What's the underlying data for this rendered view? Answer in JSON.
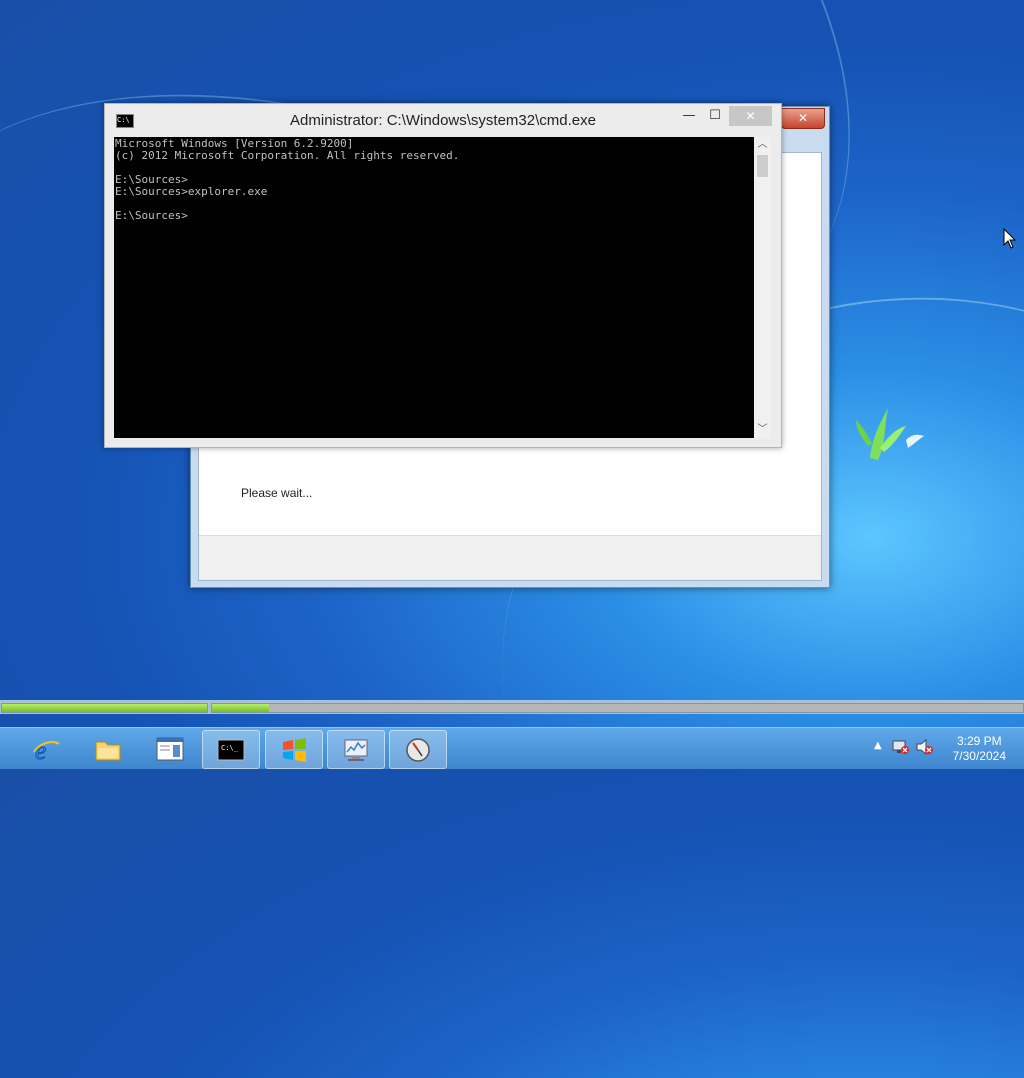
{
  "cmd_window": {
    "title": "Administrator: C:\\Windows\\system32\\cmd.exe",
    "icon": "cmd-icon",
    "console_lines": [
      "Microsoft Windows [Version 6.2.9200]",
      "(c) 2012 Microsoft Corporation. All rights reserved.",
      "",
      "E:\\Sources>",
      "E:\\Sources>explorer.exe",
      "",
      "E:\\Sources>"
    ],
    "buttons": {
      "minimize": "minimize-icon",
      "maximize": "maximize-icon",
      "close": "close-icon"
    }
  },
  "setup_window": {
    "message": "Please wait..."
  },
  "progress": {
    "step1_fraction": 1.0,
    "step2_fraction": 0.07
  },
  "taskbar": {
    "apps": [
      {
        "name": "internet-explorer",
        "icon": "ie-icon",
        "active": false
      },
      {
        "name": "file-explorer",
        "icon": "folder-icon",
        "active": false
      },
      {
        "name": "window-app",
        "icon": "window-icon",
        "active": false
      },
      {
        "name": "command-prompt",
        "icon": "cmd-icon",
        "active": true
      },
      {
        "name": "windows-logo",
        "icon": "windows-logo-icon",
        "active": true
      },
      {
        "name": "resource-monitor",
        "icon": "monitor-icon",
        "active": true
      },
      {
        "name": "clock-app",
        "icon": "clock-icon",
        "active": true
      }
    ],
    "tray": {
      "icons": [
        "chevron-up-icon",
        "network-error-icon",
        "volume-muted-icon"
      ],
      "time": "3:29 PM",
      "date": "7/30/2024"
    }
  },
  "colors": {
    "desktop_blue": "#1d64c8",
    "progress_green": "#78c022",
    "close_red": "#c7442c"
  }
}
